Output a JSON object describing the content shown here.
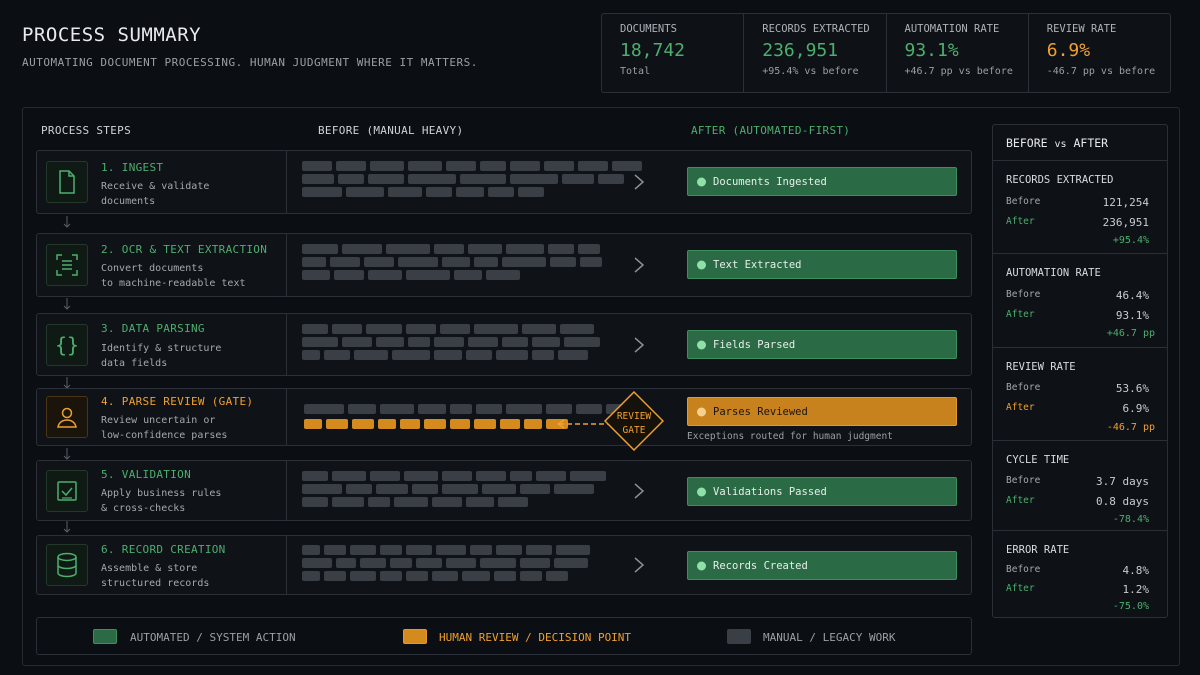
{
  "header": {
    "title": "PROCESS SUMMARY",
    "subtitle": "AUTOMATING DOCUMENT PROCESSING. HUMAN JUDGMENT WHERE IT MATTERS."
  },
  "kpis": [
    {
      "label": "DOCUMENTS",
      "value": "18,742",
      "sub": "Total",
      "color": "#4caf6e"
    },
    {
      "label": "RECORDS EXTRACTED",
      "value": "236,951",
      "sub": "+95.4% vs before",
      "color": "#4caf6e"
    },
    {
      "label": "AUTOMATION RATE",
      "value": "93.1%",
      "sub": "+46.7 pp vs before",
      "color": "#4caf6e"
    },
    {
      "label": "REVIEW RATE",
      "value": "6.9%",
      "sub": "-46.7 pp vs before",
      "color": "#f0a030"
    }
  ],
  "columns": {
    "steps": "PROCESS STEPS",
    "before": "BEFORE (MANUAL HEAVY)",
    "after": "AFTER (AUTOMATED-FIRST)"
  },
  "steps": [
    {
      "title": "1. INGEST",
      "desc1": "Receive & validate",
      "desc2": "documents",
      "result": "Documents Ingested",
      "icon": "document-icon"
    },
    {
      "title": "2. OCR & TEXT EXTRACTION",
      "desc1": "Convert documents",
      "desc2": "to machine-readable text",
      "result": "Text Extracted",
      "icon": "scan-text-icon"
    },
    {
      "title": "3. DATA PARSING",
      "desc1": "Identify & structure",
      "desc2": "data fields",
      "result": "Fields Parsed",
      "icon": "braces-icon"
    },
    {
      "title": "4. PARSE REVIEW (GATE)",
      "desc1": "Review uncertain or",
      "desc2": "low-confidence parses",
      "result": "Parses Reviewed",
      "icon": "person-icon"
    },
    {
      "title": "5. VALIDATION",
      "desc1": "Apply business rules",
      "desc2": "& cross-checks",
      "result": "Validations Passed",
      "icon": "checkbox-icon"
    },
    {
      "title": "6. RECORD CREATION",
      "desc1": "Assemble & store",
      "desc2": "structured records",
      "result": "Records Created",
      "icon": "database-icon"
    }
  ],
  "gate": {
    "line1": "REVIEW",
    "line2": "GATE",
    "note": "Exceptions routed for human judgment"
  },
  "legend": {
    "automated": "AUTOMATED / SYSTEM ACTION",
    "human": "HUMAN REVIEW / DECISION POINT",
    "manual": "MANUAL / LEGACY WORK",
    "colors": {
      "automated": "#2a6b45",
      "human": "#d48a1c",
      "manual": "#3a3e45"
    }
  },
  "comparison": {
    "title_before": "BEFORE",
    "title_vs": "vs",
    "title_after": "AFTER",
    "before_label": "Before",
    "after_label": "After",
    "metrics": [
      {
        "name": "RECORDS EXTRACTED",
        "before": "121,254",
        "after": "236,951",
        "change": "+95.4%",
        "tone": "green"
      },
      {
        "name": "AUTOMATION RATE",
        "before": "46.4%",
        "after": "93.1%",
        "change": "+46.7 pp",
        "tone": "green"
      },
      {
        "name": "REVIEW RATE",
        "before": "53.6%",
        "after": "6.9%",
        "change": "-46.7 pp",
        "tone": "orange"
      },
      {
        "name": "CYCLE TIME",
        "before": "3.7 days",
        "after": "0.8 days",
        "change": "-78.4%",
        "tone": "green"
      },
      {
        "name": "ERROR RATE",
        "before": "4.8%",
        "after": "1.2%",
        "change": "-75.0%",
        "tone": "green"
      }
    ]
  }
}
